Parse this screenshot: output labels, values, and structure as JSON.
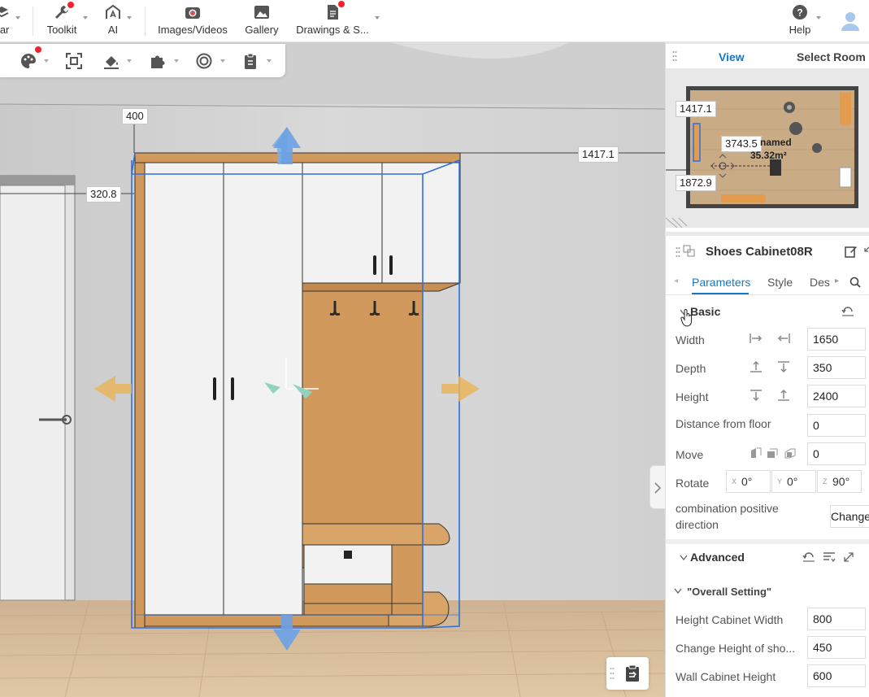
{
  "toolbar": {
    "items": [
      {
        "label": "ear",
        "icon": "layers-icon"
      },
      {
        "label": "Toolkit",
        "icon": "wrench-icon"
      },
      {
        "label": "AI",
        "icon": "ai-house-icon"
      },
      {
        "label": "Images/Videos",
        "icon": "camera-icon"
      },
      {
        "label": "Gallery",
        "icon": "image-icon"
      },
      {
        "label": "Drawings & S...",
        "icon": "document-icon"
      },
      {
        "label": "Help",
        "icon": "question-icon"
      }
    ]
  },
  "subtoolbar": {
    "icons": [
      "palette-icon",
      "select-frame-icon",
      "paint-fill-icon",
      "puzzle-icon",
      "target-icon",
      "clipboard-icon"
    ]
  },
  "scene": {
    "dimensions": {
      "top_offset": "400",
      "right_width": "1417.1",
      "left_offset": "320.8"
    }
  },
  "view_panel": {
    "tabs": {
      "view": "View",
      "select_room": "Select Room"
    },
    "minimap": {
      "dim_top": "1417.1",
      "dim_mid": "3743.5",
      "dim_bottom": "1872.9",
      "room_name": "named",
      "room_area": "35.32m²"
    }
  },
  "properties": {
    "title": "Shoes Cabinet08R",
    "tabs": {
      "parameters": "Parameters",
      "style": "Style",
      "description": "Des"
    },
    "basic": {
      "title": "Basic",
      "width": {
        "label": "Width",
        "value": "1650"
      },
      "depth": {
        "label": "Depth",
        "value": "350"
      },
      "height": {
        "label": "Height",
        "value": "2400"
      },
      "distance_from_floor": {
        "label": "Distance from floor",
        "value": "0"
      },
      "move": {
        "label": "Move",
        "value": "0"
      },
      "rotate": {
        "label": "Rotate",
        "x_axis": "X",
        "x": "0°",
        "y_axis": "Y",
        "y": "0°",
        "z_axis": "Z",
        "z": "90°"
      },
      "combination": {
        "label_line1": "combination positive",
        "label_line2": "direction",
        "button": "Change"
      }
    },
    "advanced": {
      "title": "Advanced",
      "overall_setting": "\"Overall Setting\"",
      "height_cabinet_width": {
        "label": "Height Cabinet Width",
        "value": "800"
      },
      "change_height": {
        "label": "Change Height of sho...",
        "value": "450"
      },
      "wall_cabinet_height": {
        "label": "Wall Cabinet Height",
        "value": "600"
      }
    }
  },
  "colors": {
    "accent": "#1677c8",
    "wood": "#d19a5c",
    "wood_dark": "#b37a3f",
    "selection": "#2e6fe0",
    "floor": "#d9bf9b",
    "wall": "#d6d6d6"
  }
}
